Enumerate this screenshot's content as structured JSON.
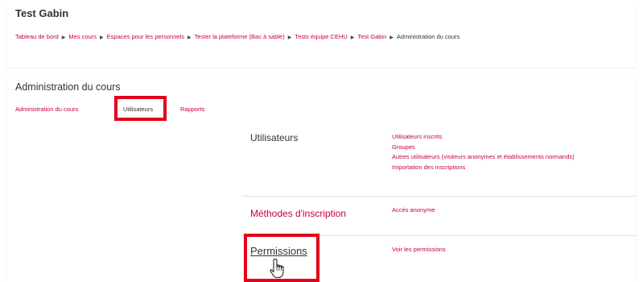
{
  "header": {
    "course_name": "Test Gabin",
    "breadcrumb": [
      "Tableau de bord",
      "Mes cours",
      "Espaces pour les personnels",
      "Tester la plateforme (Bac à sable)",
      "Tests équipe CEHU",
      "Test Gabin",
      "Administration du cours"
    ]
  },
  "admin": {
    "title": "Administration du cours",
    "tabs": [
      {
        "label": "Administration du cours"
      },
      {
        "label": "Utilisateurs"
      },
      {
        "label": "Rapports"
      }
    ],
    "active_tab": "Utilisateurs"
  },
  "sections": {
    "utilisateurs": {
      "title": "Utilisateurs",
      "links": [
        "Utilisateurs inscrits",
        "Groupes",
        "Autres utilisateurs (visiteurs anonymes et établissements normands)",
        "Importation des inscriptions"
      ]
    },
    "methodes": {
      "title": "Méthodes d'inscription",
      "links": [
        "Accès anonyme"
      ]
    },
    "permissions": {
      "title": "Permissions",
      "links": [
        "Voir les permissions"
      ]
    }
  },
  "colors": {
    "accent": "#c5003e",
    "highlight": "#e2001a",
    "text": "#333333"
  },
  "icons": [
    "breadcrumb-arrow-icon",
    "hand-pointer-cursor-icon"
  ]
}
